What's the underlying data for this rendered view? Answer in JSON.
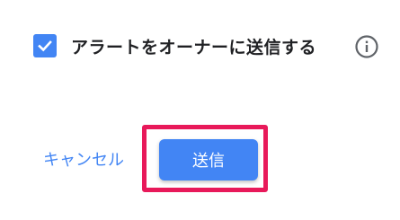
{
  "alert_option": {
    "label": "アラートをオーナーに送信する",
    "checked": true,
    "checkbox_icon": "check-icon",
    "info_icon": "info-icon"
  },
  "actions": {
    "cancel_label": "キャンセル",
    "send_label": "送信"
  },
  "colors": {
    "accent": "#4285f4",
    "text": "#202124",
    "info_icon": "#5f6368",
    "highlight": "#e8195a"
  }
}
